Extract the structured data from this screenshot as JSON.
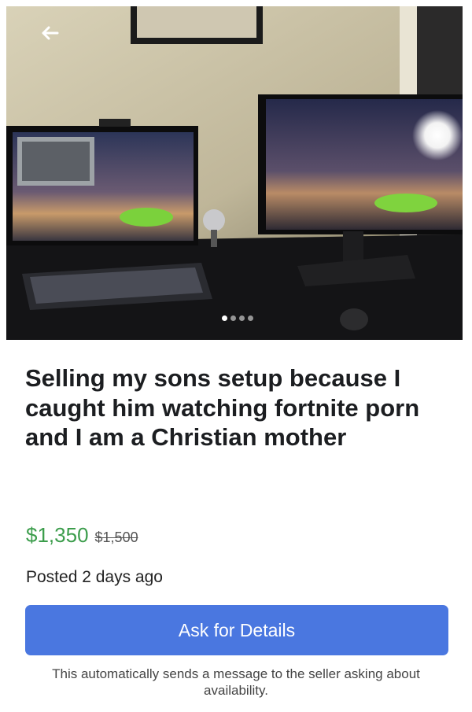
{
  "listing": {
    "title": "Selling my sons setup because I caught him watching fortnite porn and I am a Christian mother",
    "price": "$1,350",
    "original_price": "$1,500",
    "posted": "Posted 2 days ago",
    "image_count": 4,
    "active_image": 1
  },
  "actions": {
    "ask_label": "Ask for Details",
    "helper_text": "This automatically sends a message to the seller asking about availability."
  },
  "icons": {
    "back": "back-arrow-icon"
  },
  "colors": {
    "price_green": "#3c9d4c",
    "button_blue": "#4a77e0"
  }
}
